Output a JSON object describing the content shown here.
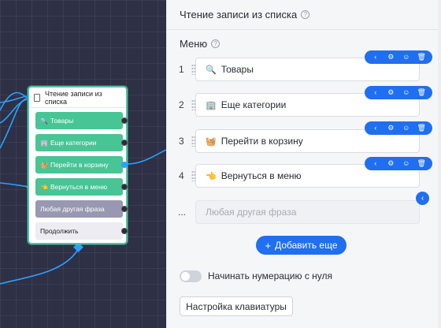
{
  "canvas": {
    "node": {
      "title": "Чтение записи из списка",
      "buttons": [
        {
          "icon": "🔍",
          "label": "Товары",
          "style": "green"
        },
        {
          "icon": "🏢",
          "label": "Еще категории",
          "style": "green"
        },
        {
          "icon": "🧺",
          "label": "Перейти в корзину",
          "style": "green"
        },
        {
          "icon": "👈",
          "label": "Вернуться в меню",
          "style": "green"
        },
        {
          "icon": "",
          "label": "Любая другая фраза",
          "style": "grey"
        },
        {
          "icon": "",
          "label": "Продолжить",
          "style": "plain"
        }
      ]
    }
  },
  "panel": {
    "title": "Чтение записи из списка",
    "menu_label": "Меню",
    "help_symbol": "?",
    "items": [
      {
        "num": "1",
        "icon": "🔍",
        "label": "Товары"
      },
      {
        "num": "2",
        "icon": "🏢",
        "label": "Еще категории"
      },
      {
        "num": "3",
        "icon": "🧺",
        "label": "Перейти в корзину"
      },
      {
        "num": "4",
        "icon": "👈",
        "label": "Вернуться в меню"
      }
    ],
    "other_row": {
      "num": "...",
      "placeholder": "Любая другая фраза"
    },
    "toolbar_icons": {
      "collapse": "‹",
      "settings": "⚙",
      "emoji": "☺",
      "delete": "🗑"
    },
    "add_button": {
      "plus": "+",
      "label": "Добавить еще"
    },
    "toggle_label": "Начинать нумерацию с нуля",
    "keyboard_button": "Настройка клавиатуры"
  },
  "colors": {
    "accent": "#1f6ff0",
    "node_green": "#47c594",
    "node_border": "#4ec6a6",
    "wire": "#2aa0ff"
  }
}
